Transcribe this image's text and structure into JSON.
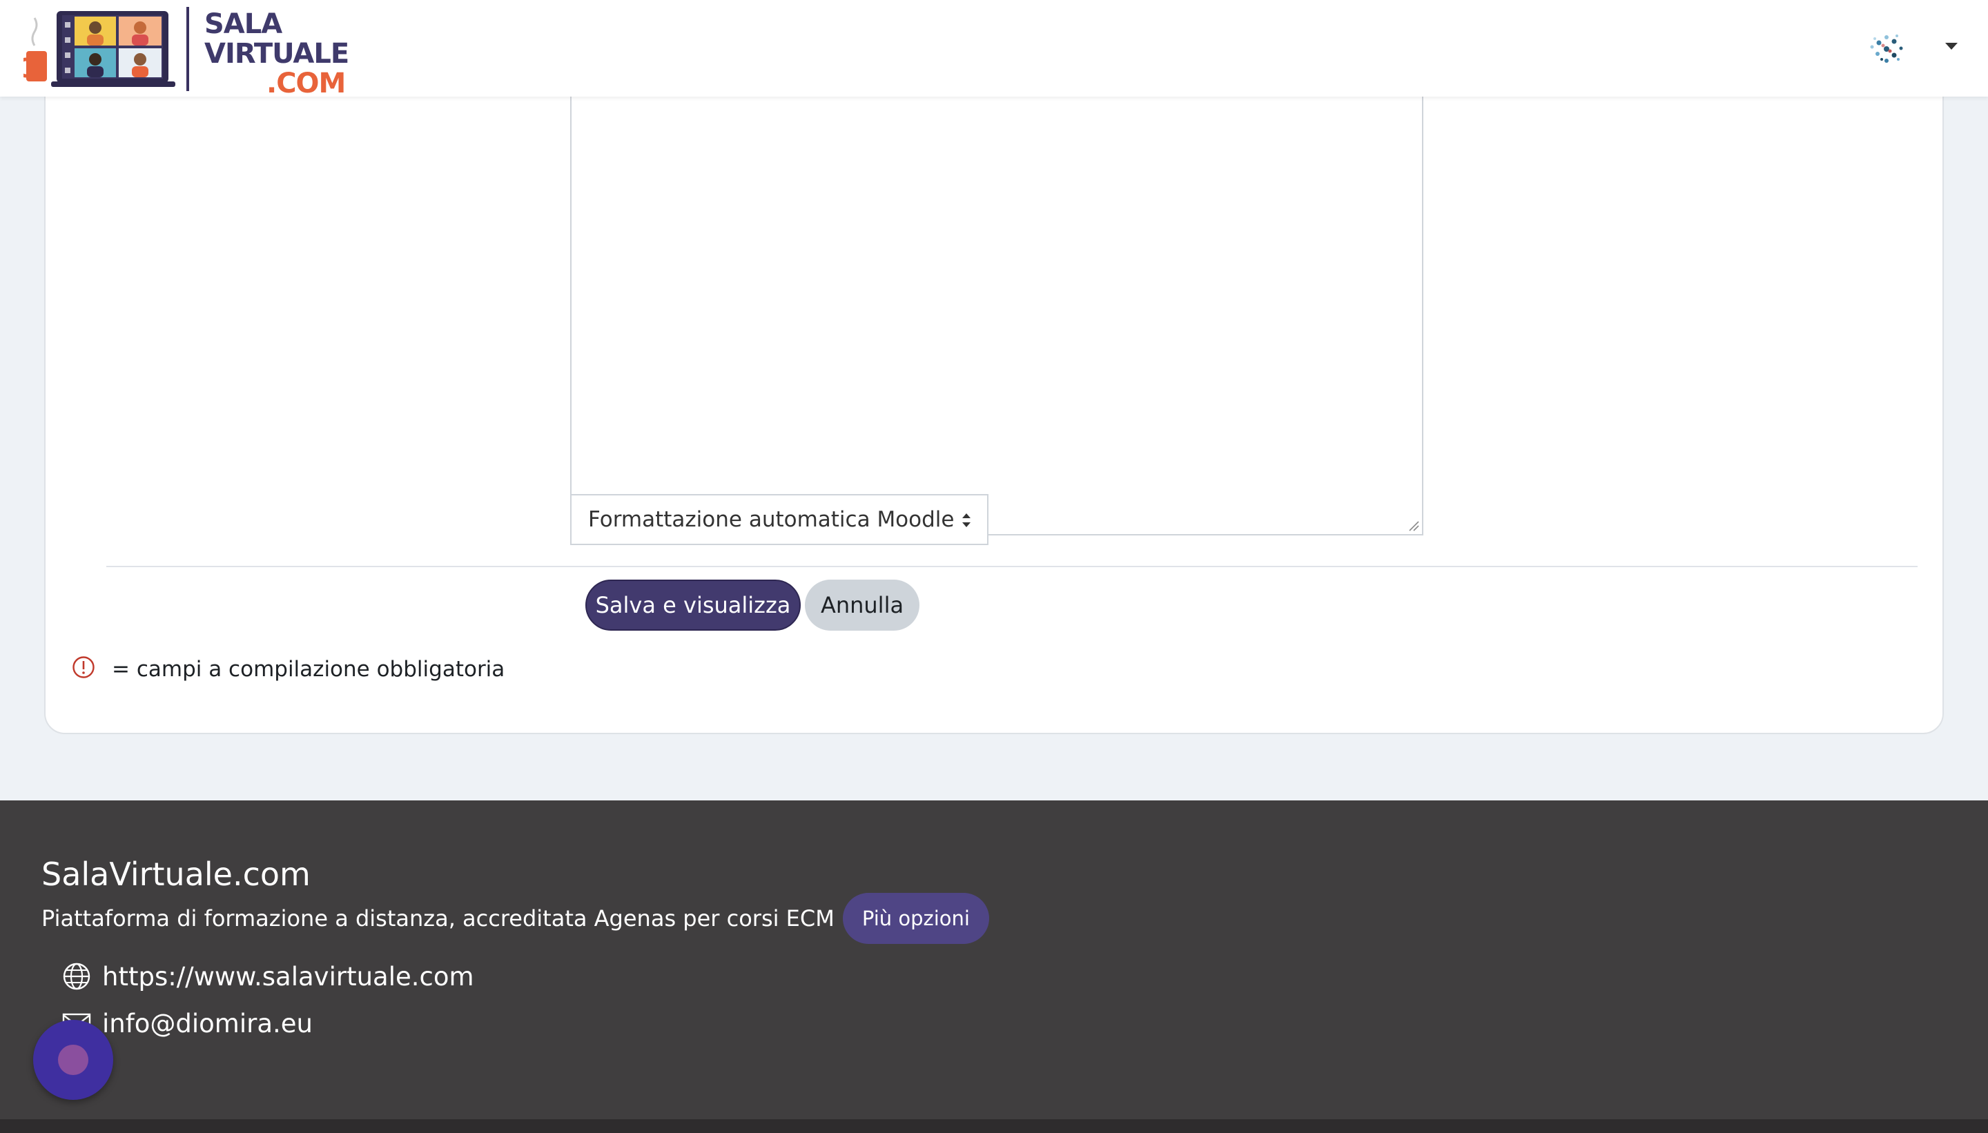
{
  "header": {
    "logo_alt": "SalaVirtuale.com",
    "logo_line1": "SALA",
    "logo_line2": "VIRTUALE",
    "logo_line3": ".COM",
    "user_menu_icon": "user-avatar-icon"
  },
  "form": {
    "text_format_value": "Formattazione automatica Moodle",
    "save_label": "Salva e visualizza",
    "cancel_label": "Annulla",
    "required_note": "= campi a compilazione obbligatoria",
    "required_icon": "exclamation-circle-icon"
  },
  "footer": {
    "title": "SalaVirtuale.com",
    "description": "Piattaforma di formazione a distanza, accreditata Agenas per corsi ECM",
    "more_options_label": "Più opzioni",
    "website_url": "https://www.salavirtuale.com",
    "email": "info@diomira.eu"
  },
  "colors": {
    "primary": "#423a6e",
    "accent": "#e8633a",
    "footer_bg": "#403e3f",
    "page_bg": "#eef2f6",
    "required": "#c0392b"
  }
}
